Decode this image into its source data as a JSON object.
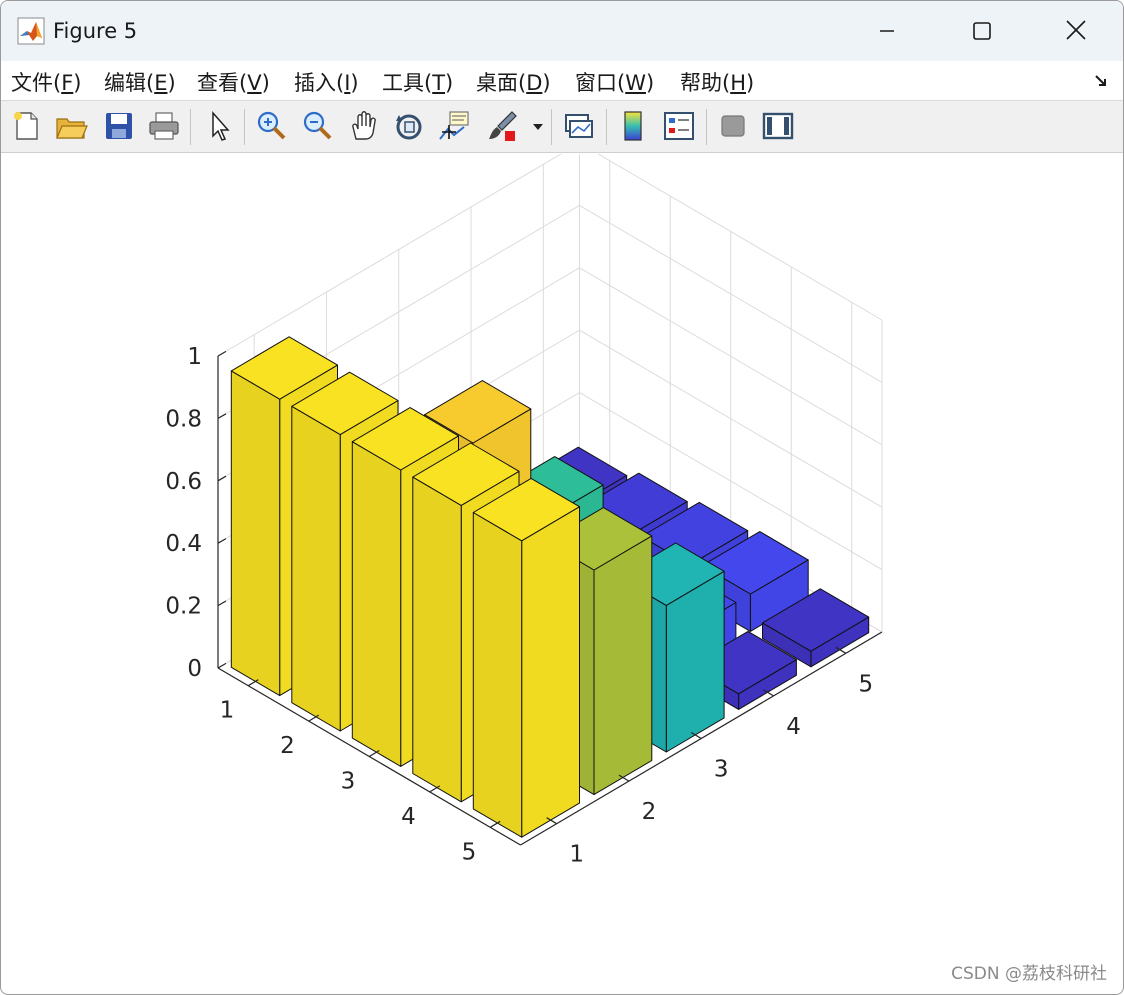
{
  "window": {
    "title": "Figure 5",
    "minimize_label": "—",
    "maximize_label": "☐",
    "close_label": "✕"
  },
  "menu": [
    {
      "text": "文件(",
      "key": "F",
      "end": ")"
    },
    {
      "text": "编辑(",
      "key": "E",
      "end": ")"
    },
    {
      "text": "查看(",
      "key": "V",
      "end": ")"
    },
    {
      "text": "插入(",
      "key": "I",
      "end": ")"
    },
    {
      "text": "工具(",
      "key": "T",
      "end": ")"
    },
    {
      "text": "桌面(",
      "key": "D",
      "end": ")"
    },
    {
      "text": "窗口(",
      "key": "W",
      "end": ")"
    },
    {
      "text": "帮助(",
      "key": "H",
      "end": ")"
    }
  ],
  "toolbar": [
    {
      "name": "new-figure-icon"
    },
    {
      "name": "open-file-icon"
    },
    {
      "name": "save-icon"
    },
    {
      "name": "print-icon"
    },
    {
      "name": "pointer-icon"
    },
    {
      "name": "zoom-in-icon"
    },
    {
      "name": "zoom-out-icon"
    },
    {
      "name": "pan-hand-icon"
    },
    {
      "name": "rotate-3d-icon"
    },
    {
      "name": "data-cursor-icon"
    },
    {
      "name": "brush-icon"
    },
    {
      "name": "link-plot-icon"
    },
    {
      "name": "colorbar-icon"
    },
    {
      "name": "legend-icon"
    },
    {
      "name": "hide-plot-tools-icon"
    },
    {
      "name": "show-plot-tools-icon"
    }
  ],
  "colors": {
    "titlebar": "#eef3f8",
    "toolbar": "#f0f0f0",
    "grid": "#dcdcdc",
    "axis": "#262626",
    "bar_edge": "#111111"
  },
  "chart_data": {
    "type": "bar3",
    "x": [
      1,
      2,
      3,
      4,
      5
    ],
    "y": [
      1,
      2,
      3,
      4,
      5
    ],
    "xtick_labels": [
      "1",
      "2",
      "3",
      "4",
      "5"
    ],
    "ytick_labels": [
      "1",
      "2",
      "3",
      "4",
      "5"
    ],
    "ztick_labels": [
      "0",
      "0.2",
      "0.4",
      "0.6",
      "0.8",
      "1"
    ],
    "zlim": [
      0,
      1
    ],
    "grid": true,
    "colormap": "parula",
    "values": [
      [
        0.95,
        0.55,
        0.25,
        0.05,
        0.05
      ],
      [
        0.95,
        0.35,
        0.02,
        0.13,
        0.08
      ],
      [
        0.95,
        0.9,
        0.52,
        0.07,
        0.1
      ],
      [
        0.95,
        0.25,
        0.15,
        0.12,
        0.12
      ],
      [
        0.95,
        0.72,
        0.47,
        0.05,
        0.05
      ]
    ]
  },
  "watermark": "CSDN @荔枝科研社"
}
